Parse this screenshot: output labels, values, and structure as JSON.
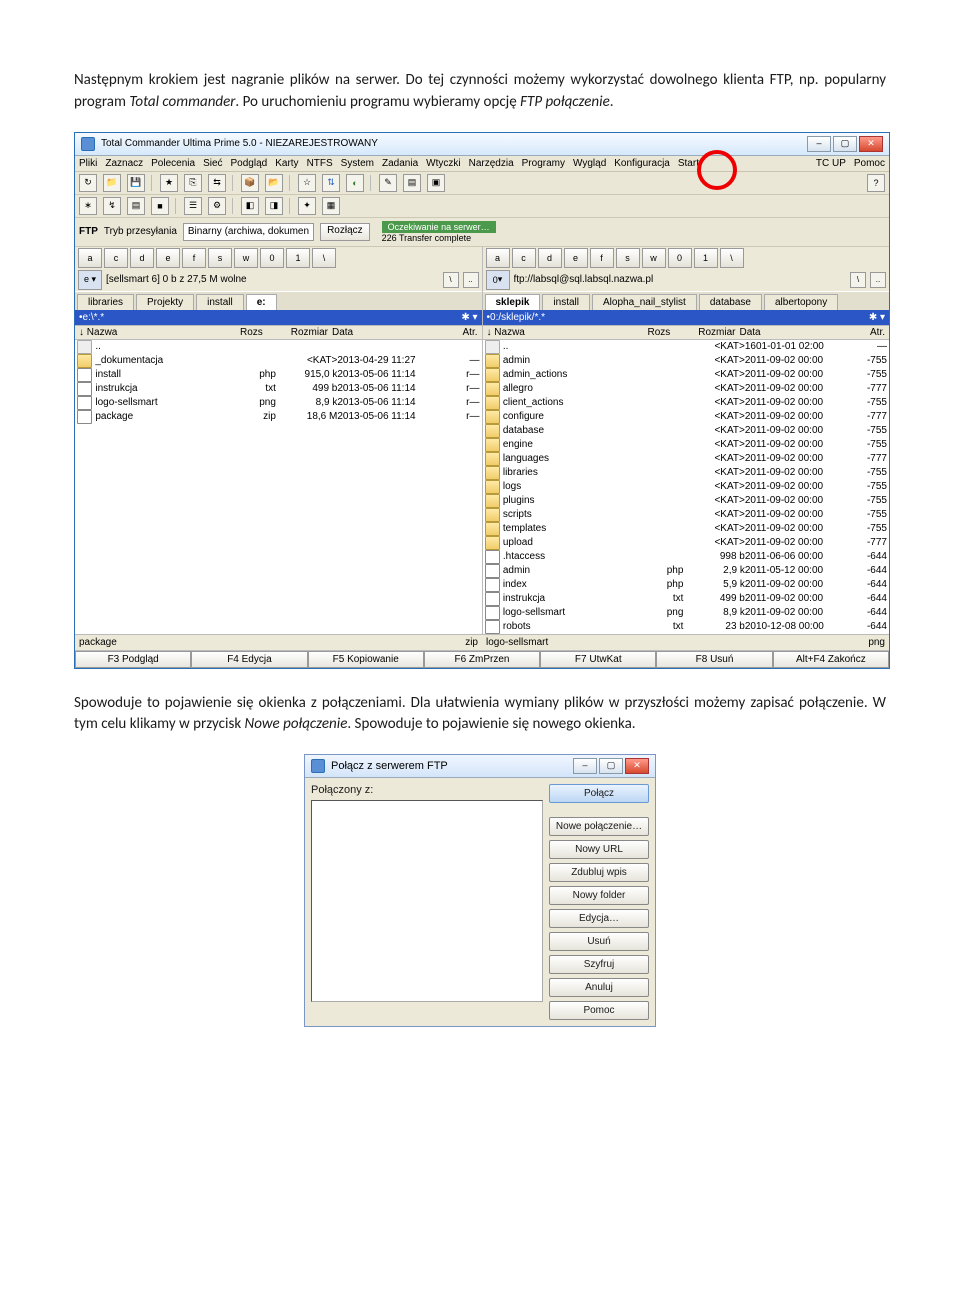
{
  "para1_a": "Następnym krokiem jest nagranie plików na serwer. Do tej czynności możemy wykorzystać dowolnego klienta FTP, np. popularny program ",
  "para1_it": "Total commander",
  "para1_b": ". Po uruchomieniu programu wybieramy opcję ",
  "para1_it2": "FTP połączenie",
  "para1_c": ".",
  "para2_a": "Spowoduje to pojawienie się okienka z połączeniami. Dla ułatwienia wymiany plików w przyszłości możemy zapisać połączenie. W tym celu klikamy w przycisk ",
  "para2_it": "Nowe połączenie",
  "para2_b": ". Spowoduje to pojawienie się nowego okienka.",
  "tc": {
    "title": "Total Commander Ultima Prime 5.0 - NIEZAREJESTROWANY",
    "menu": [
      "Pliki",
      "Zaznacz",
      "Polecenia",
      "Sieć",
      "Podgląd",
      "Karty",
      "NTFS",
      "System",
      "Zadania",
      "Wtyczki",
      "Narzędzia",
      "Programy",
      "Wygląd",
      "Konfiguracja",
      "Start"
    ],
    "menu_right": [
      "TC UP",
      "Pomoc"
    ],
    "ftp_label": "FTP",
    "ftp_mode": "Tryb przesyłania",
    "ftp_mode_val": "Binarny (archiwa, dokumen",
    "disconnect": "Rozłącz",
    "status1": "Oczekiwanie na serwer…",
    "status2": "226 Transfer complete",
    "drives": [
      "a",
      "c",
      "d",
      "e",
      "f",
      "s",
      "w",
      "0",
      "1",
      "\\"
    ],
    "left_status": "[sellsmart 6]  0 b z 27,5 M wolne",
    "right_status": "0",
    "right_path_top": "ftp://labsql@sql.labsql.nazwa.pl",
    "left_tabs": [
      "libraries",
      "Projekty",
      "install",
      "e:"
    ],
    "right_tabs": [
      "sklepik",
      "install",
      "Alopha_nail_stylist",
      "database",
      "albertopony"
    ],
    "left_path": "•e:\\*.*",
    "right_path": "•0:/sklepik/*.*",
    "hdr": [
      "Nazwa",
      "Rozs",
      "Rozmiar",
      "Data",
      "Atr."
    ],
    "left_rows": [
      {
        "n": "..",
        "ico": "up",
        "e": "",
        "s": "",
        "d": "",
        "a": ""
      },
      {
        "n": "_dokumentacja",
        "ico": "dir",
        "e": "",
        "s": "<KAT>",
        "d": "2013-04-29 11:27",
        "a": "—"
      },
      {
        "n": "install",
        "ico": "file",
        "e": "php",
        "s": "915,0 k",
        "d": "2013-05-06 11:14",
        "a": "r—"
      },
      {
        "n": "instrukcja",
        "ico": "file",
        "e": "txt",
        "s": "499 b",
        "d": "2013-05-06 11:14",
        "a": "r—"
      },
      {
        "n": "logo-sellsmart",
        "ico": "file",
        "e": "png",
        "s": "8,9 k",
        "d": "2013-05-06 11:14",
        "a": "r—"
      },
      {
        "n": "package",
        "ico": "file",
        "e": "zip",
        "s": "18,6 M",
        "d": "2013-05-06 11:14",
        "a": "r—"
      }
    ],
    "right_rows": [
      {
        "n": "..",
        "ico": "up",
        "e": "",
        "s": "<KAT>",
        "d": "1601-01-01 02:00",
        "a": "—"
      },
      {
        "n": "admin",
        "ico": "dir",
        "e": "",
        "s": "<KAT>",
        "d": "2011-09-02 00:00",
        "a": "-755"
      },
      {
        "n": "admin_actions",
        "ico": "dir",
        "e": "",
        "s": "<KAT>",
        "d": "2011-09-02 00:00",
        "a": "-755"
      },
      {
        "n": "allegro",
        "ico": "dir",
        "e": "",
        "s": "<KAT>",
        "d": "2011-09-02 00:00",
        "a": "-777"
      },
      {
        "n": "client_actions",
        "ico": "dir",
        "e": "",
        "s": "<KAT>",
        "d": "2011-09-02 00:00",
        "a": "-755"
      },
      {
        "n": "configure",
        "ico": "dir",
        "e": "",
        "s": "<KAT>",
        "d": "2011-09-02 00:00",
        "a": "-777"
      },
      {
        "n": "database",
        "ico": "dir",
        "e": "",
        "s": "<KAT>",
        "d": "2011-09-02 00:00",
        "a": "-755"
      },
      {
        "n": "engine",
        "ico": "dir",
        "e": "",
        "s": "<KAT>",
        "d": "2011-09-02 00:00",
        "a": "-755"
      },
      {
        "n": "languages",
        "ico": "dir",
        "e": "",
        "s": "<KAT>",
        "d": "2011-09-02 00:00",
        "a": "-777"
      },
      {
        "n": "libraries",
        "ico": "dir",
        "e": "",
        "s": "<KAT>",
        "d": "2011-09-02 00:00",
        "a": "-755"
      },
      {
        "n": "logs",
        "ico": "dir",
        "e": "",
        "s": "<KAT>",
        "d": "2011-09-02 00:00",
        "a": "-755"
      },
      {
        "n": "plugins",
        "ico": "dir",
        "e": "",
        "s": "<KAT>",
        "d": "2011-09-02 00:00",
        "a": "-755"
      },
      {
        "n": "scripts",
        "ico": "dir",
        "e": "",
        "s": "<KAT>",
        "d": "2011-09-02 00:00",
        "a": "-755"
      },
      {
        "n": "templates",
        "ico": "dir",
        "e": "",
        "s": "<KAT>",
        "d": "2011-09-02 00:00",
        "a": "-755"
      },
      {
        "n": "upload",
        "ico": "dir",
        "e": "",
        "s": "<KAT>",
        "d": "2011-09-02 00:00",
        "a": "-777"
      },
      {
        "n": ".htaccess",
        "ico": "file",
        "e": "",
        "s": "998 b",
        "d": "2011-06-06 00:00",
        "a": "-644"
      },
      {
        "n": "admin",
        "ico": "file",
        "e": "php",
        "s": "2,9 k",
        "d": "2011-05-12 00:00",
        "a": "-644"
      },
      {
        "n": "index",
        "ico": "file",
        "e": "php",
        "s": "5,9 k",
        "d": "2011-09-02 00:00",
        "a": "-644"
      },
      {
        "n": "instrukcja",
        "ico": "file",
        "e": "txt",
        "s": "499 b",
        "d": "2011-09-02 00:00",
        "a": "-644"
      },
      {
        "n": "logo-sellsmart",
        "ico": "file",
        "e": "png",
        "s": "8,9 k",
        "d": "2011-09-02 00:00",
        "a": "-644"
      },
      {
        "n": "robots",
        "ico": "file",
        "e": "txt",
        "s": "23 b",
        "d": "2010-12-08 00:00",
        "a": "-644"
      }
    ],
    "bottom_left": [
      "package",
      "zip"
    ],
    "bottom_right": [
      "logo-sellsmart",
      "png"
    ],
    "fkeys": [
      "F3 Podgląd",
      "F4 Edycja",
      "F5 Kopiowanie",
      "F6 ZmPrzen",
      "F7 UtwKat",
      "F8 Usuń",
      "Alt+F4 Zakończ"
    ]
  },
  "dlg": {
    "title": "Połącz z serwerem FTP",
    "label": "Połączony z:",
    "btns": [
      "Połącz",
      "Nowe połączenie…",
      "Nowy URL",
      "Zdubluj wpis",
      "Nowy folder",
      "Edycja…",
      "Usuń",
      "Szyfruj",
      "Anuluj",
      "Pomoc"
    ]
  }
}
